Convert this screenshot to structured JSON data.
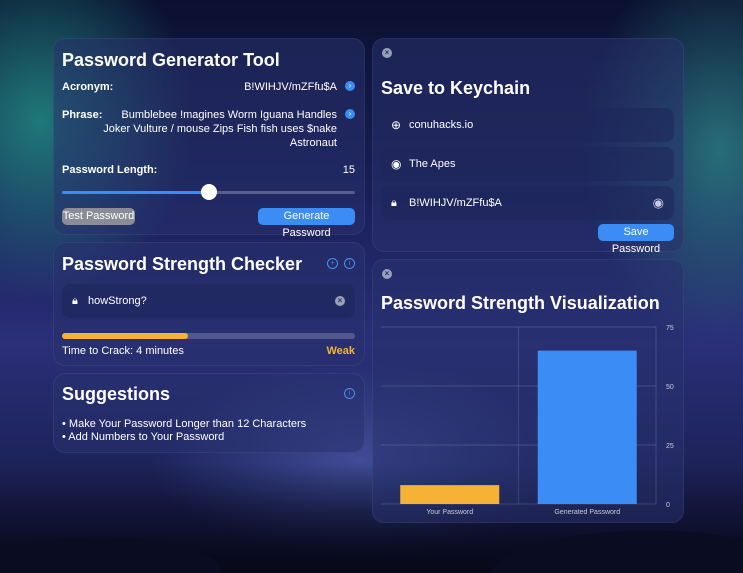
{
  "generator": {
    "title": "Password Generator Tool",
    "acronym_label": "Acronym:",
    "acronym_value": "B!WIHJV/mZFfu$A",
    "phrase_label": "Phrase:",
    "phrase_line1": "Bumblebee !magines Worm Iguana Handles",
    "phrase_line2": "Joker Vulture / mouse Zips Fish fish uses $nake",
    "phrase_line3": "Astronaut",
    "length_label": "Password Length:",
    "length_value": "15",
    "slider_fraction": 0.5,
    "test_button": "Test Password",
    "generate_button": "Generate Password"
  },
  "strength": {
    "title": "Password Strength Checker",
    "input_value": "howStrong?",
    "progress_fraction": 0.43,
    "crack_time": "Time to Crack: 4 minutes",
    "rating": "Weak",
    "rating_color": "#f5b234"
  },
  "suggestions": {
    "title": "Suggestions",
    "items": [
      "• Make Your Password Longer than 12 Characters",
      "• Add Numbers to Your Password"
    ]
  },
  "keychain": {
    "title": "Save to Keychain",
    "website": "conuhacks.io",
    "username": "The Apes",
    "password": "B!WIHJV/mZFfu$A",
    "save_button": "Save Password"
  },
  "chart_data": {
    "type": "bar",
    "title": "Password Strength Visualization",
    "categories": [
      "Your Password",
      "Generated Password"
    ],
    "values": [
      8,
      65
    ],
    "colors": [
      "#f5b234",
      "#3b8cf5"
    ],
    "ylim": [
      0,
      75
    ],
    "yticks": [
      "0",
      "25",
      "50",
      "75"
    ],
    "grid": true
  }
}
